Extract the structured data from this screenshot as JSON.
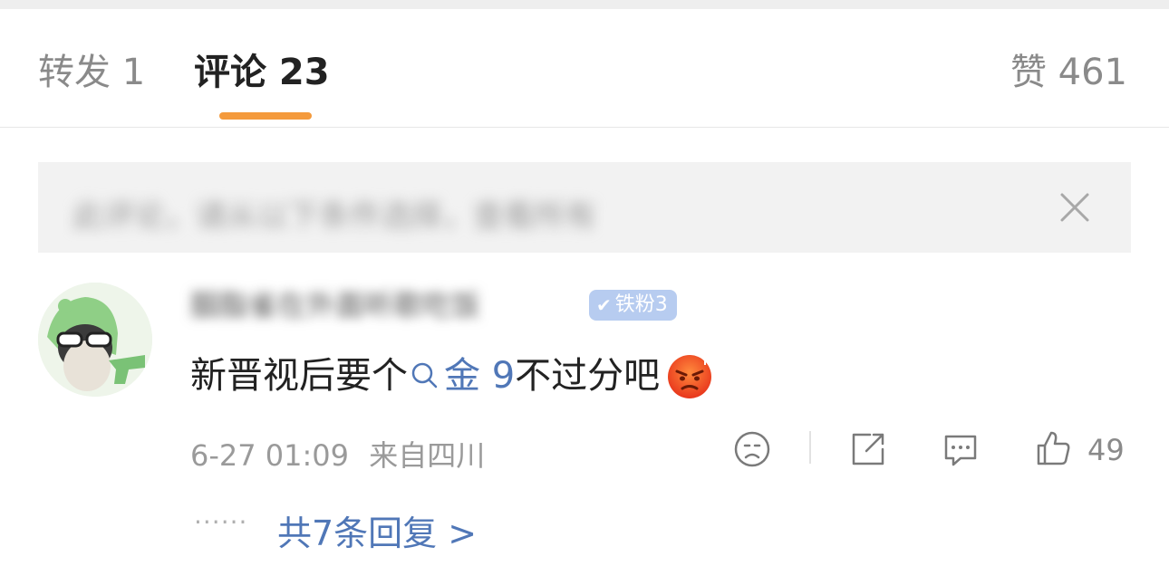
{
  "tabs": {
    "forward": "转发 1",
    "comment": "评论 23",
    "like": "赞 461"
  },
  "notice": {
    "text": "此评论，请从以下条件选择，查看所有"
  },
  "comment": {
    "username": "胭脂雀在外面听歌吃饭",
    "badge": "铁粉3",
    "text_before": "新晋视后要个",
    "search_term": "金 9",
    "text_after": "不过分吧",
    "timestamp": "6-27 01:09",
    "location": "来自四川",
    "like_count": "49",
    "reply_dots": "······",
    "reply_link": "共7条回复 >"
  },
  "colors": {
    "accent": "#f49a3c",
    "link": "#5077b7",
    "badge": "#b7ccf0"
  }
}
